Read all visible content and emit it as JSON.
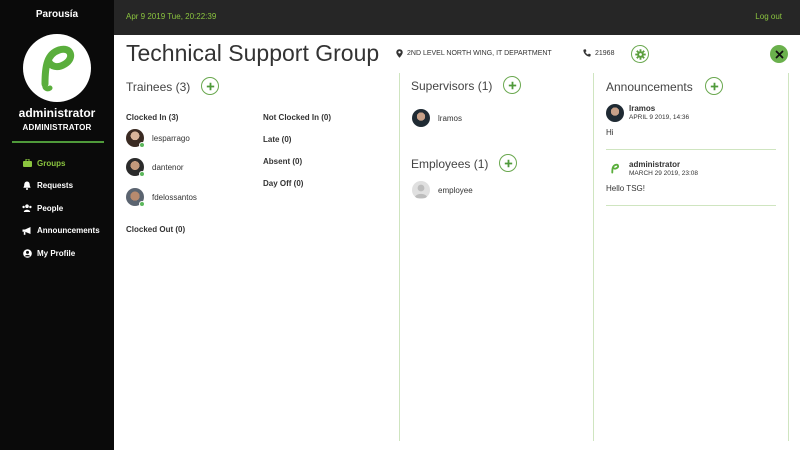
{
  "app": {
    "brand": "Parousía"
  },
  "user": {
    "name": "administrator",
    "role": "ADMINISTRATOR"
  },
  "nav": [
    {
      "label": "Groups",
      "icon": "briefcase-icon",
      "active": true
    },
    {
      "label": "Requests",
      "icon": "bell-icon"
    },
    {
      "label": "People",
      "icon": "users-icon"
    },
    {
      "label": "Announcements",
      "icon": "megaphone-icon"
    },
    {
      "label": "My Profile",
      "icon": "user-circle-icon"
    }
  ],
  "topbar": {
    "datetime": "Apr 9 2019 Tue, 20:22:39",
    "logout": "Log out"
  },
  "group": {
    "title": "Technical Support Group",
    "location": "2ND LEVEL NORTH WING, IT DEPARTMENT",
    "phone": "21968"
  },
  "trainees": {
    "heading": "Trainees (3)",
    "clocked_in_label": "Clocked In (3)",
    "clocked_in": [
      "lesparrago",
      "dantenor",
      "fdelossantos"
    ],
    "clocked_out_label": "Clocked Out (0)",
    "not_clocked_in_label": "Not Clocked In (0)",
    "late_label": "Late (0)",
    "absent_label": "Absent (0)",
    "day_off_label": "Day Off (0)"
  },
  "supervisors": {
    "heading": "Supervisors (1)",
    "members": [
      "lramos"
    ]
  },
  "employees": {
    "heading": "Employees (1)",
    "members": [
      "employee"
    ]
  },
  "announcements": {
    "heading": "Announcements",
    "items": [
      {
        "author": "lramos",
        "date": "APRIL 9 2019, 14:36",
        "body": "Hi"
      },
      {
        "author": "administrator",
        "date": "MARCH 29 2019, 23:08",
        "body": "Hello TSG!"
      }
    ]
  },
  "colors": {
    "accent": "#8bc53f",
    "sidebar": "#0a0a0a",
    "topbar": "#262626",
    "online": "#5cb85c"
  }
}
